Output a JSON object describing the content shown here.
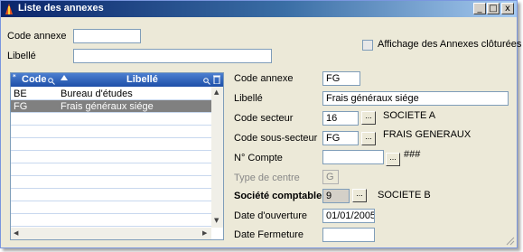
{
  "window": {
    "title": "Liste des annexes",
    "buttons": [
      "_",
      "□",
      "x"
    ]
  },
  "filter": {
    "code_label": "Code annexe",
    "code_value": "",
    "libelle_label": "Libellé",
    "libelle_value": "",
    "closed_checkbox_label": "Affichage des Annexes clôturées",
    "closed_checked": false
  },
  "grid": {
    "headers": {
      "code": "Code",
      "libelle": "Libellé"
    },
    "rows": [
      {
        "code": "BE",
        "libelle": "Bureau d'études",
        "selected": false
      },
      {
        "code": "FG",
        "libelle": "Frais généraux siége",
        "selected": true
      }
    ]
  },
  "form": {
    "code_annexe": {
      "label": "Code annexe",
      "value": "FG"
    },
    "libelle": {
      "label": "Libellé",
      "value": "Frais généraux siége"
    },
    "code_secteur": {
      "label": "Code secteur",
      "value": "16",
      "desc": "SOCIETE A"
    },
    "code_sous_secteur": {
      "label": "Code sous-secteur",
      "value": "FG",
      "desc": "FRAIS GENERAUX"
    },
    "n_compte": {
      "label": "N° Compte",
      "value": "",
      "desc": "###"
    },
    "type_centre": {
      "label": "Type de centre",
      "value": "G"
    },
    "societe": {
      "label": "Société comptable",
      "value": "9",
      "desc": "SOCIETE B"
    },
    "date_ouverture": {
      "label": "Date d'ouverture",
      "value": "01/01/2005"
    },
    "date_fermeture": {
      "label": "Date Fermeture",
      "value": ""
    },
    "browse_label": "..."
  }
}
